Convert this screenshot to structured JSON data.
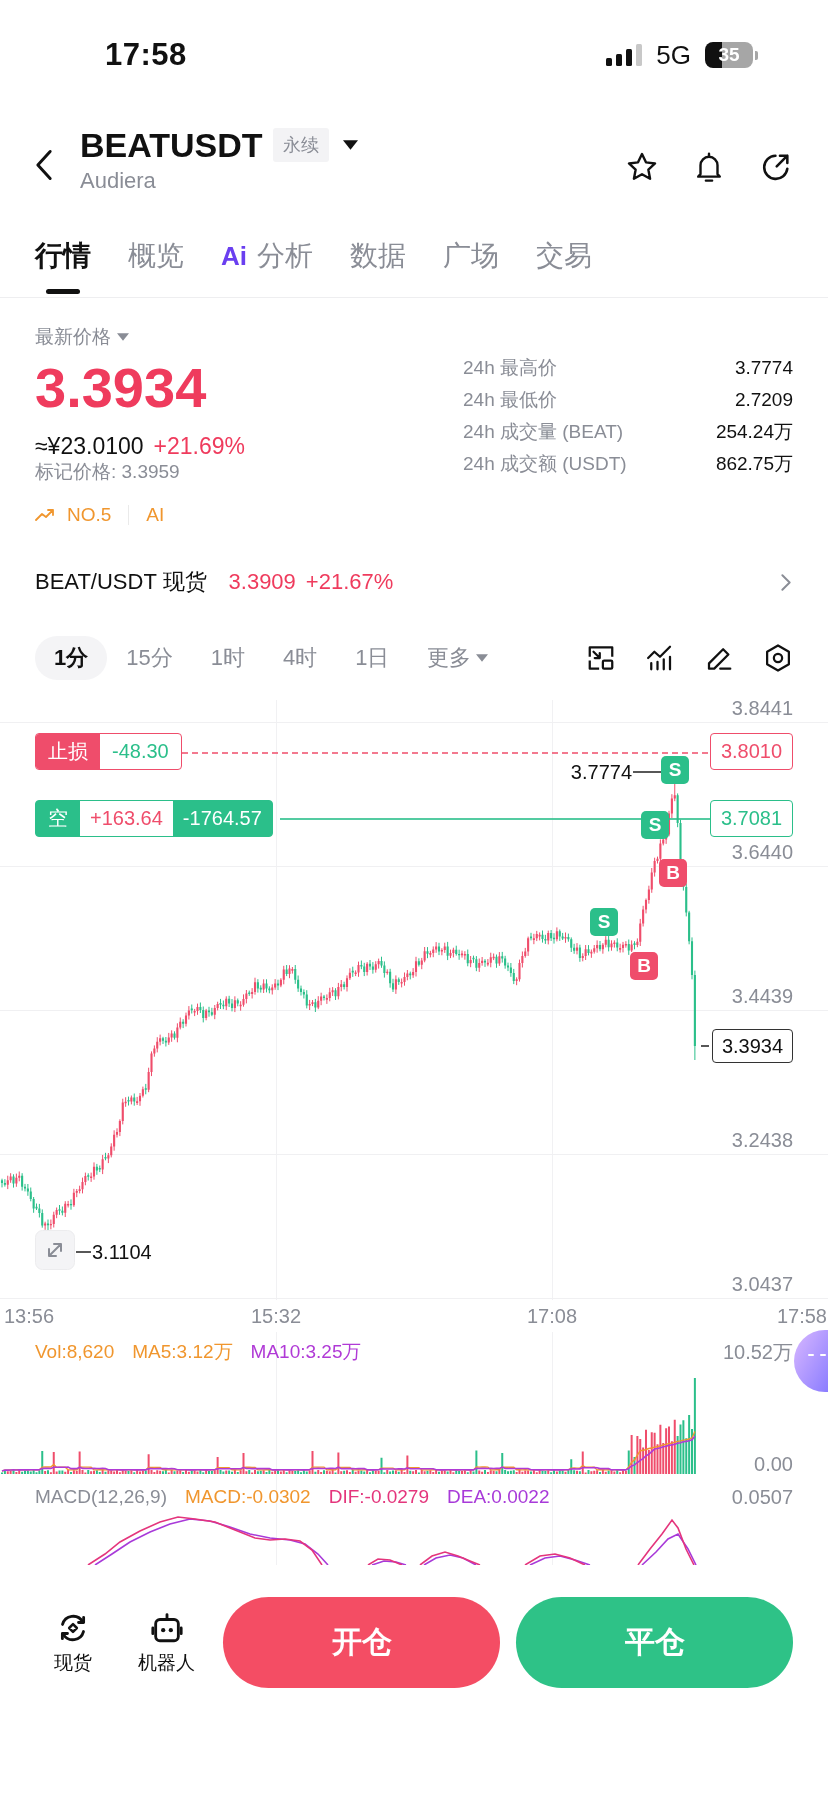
{
  "status_bar": {
    "time": "17:58",
    "network": "5G",
    "battery": "35"
  },
  "header": {
    "symbol": "BEATUSDT",
    "badge": "永续",
    "subtitle": "Audiera"
  },
  "tabs": [
    {
      "label": "行情",
      "selected": true
    },
    {
      "label": "概览",
      "selected": false
    },
    {
      "label": "分析",
      "icon_text": "Ai",
      "selected": false
    },
    {
      "label": "数据",
      "selected": false
    },
    {
      "label": "广场",
      "selected": false
    },
    {
      "label": "交易",
      "selected": false
    }
  ],
  "price": {
    "label": "最新价格",
    "last": "3.3934",
    "fiat": "≈¥23.0100",
    "change": "+21.69%",
    "mark": "标记价格: 3.3959",
    "rank": "NO.5",
    "ai": "AI"
  },
  "stats": [
    {
      "label": "24h 最高价",
      "value": "3.7774"
    },
    {
      "label": "24h 最低价",
      "value": "2.7209"
    },
    {
      "label": "24h 成交量 (BEAT)",
      "value": "254.24万"
    },
    {
      "label": "24h 成交额 (USDT)",
      "value": "862.75万"
    }
  ],
  "spot": {
    "pair": "BEAT/USDT 现货",
    "price": "3.3909",
    "change": "+21.67%"
  },
  "intervals": [
    {
      "label": "1分",
      "kind": "interval",
      "selected": true
    },
    {
      "label": "15分",
      "kind": "interval",
      "selected": false
    },
    {
      "label": "1时",
      "kind": "interval",
      "selected": false
    },
    {
      "label": "4时",
      "kind": "interval",
      "selected": false
    },
    {
      "label": "1日",
      "kind": "interval",
      "selected": false
    },
    {
      "label": "更多",
      "kind": "dropdown",
      "selected": false
    }
  ],
  "chart": {
    "price_axis": [
      "3.8441",
      "3.6440",
      "3.4439",
      "3.2438",
      "3.0437"
    ],
    "time_axis": [
      "13:56",
      "15:32",
      "17:08",
      "17:58"
    ],
    "stop_loss": {
      "label": "止损",
      "pnl": "-48.30",
      "price": "3.8010"
    },
    "position": {
      "side": "空",
      "pnl": "+163.64",
      "amount": "-1764.57",
      "price": "3.7081"
    },
    "high": "3.7774",
    "low": "3.1104",
    "last": "3.3934",
    "trades": [
      {
        "label": "S",
        "kind": "sell"
      },
      {
        "label": "S",
        "kind": "sell"
      },
      {
        "label": "B",
        "kind": "buy"
      },
      {
        "label": "S",
        "kind": "sell"
      },
      {
        "label": "B",
        "kind": "buy"
      }
    ]
  },
  "volume": {
    "legend": [
      {
        "label": "Vol:8,620",
        "color": "#f0962e"
      },
      {
        "label": "MA5:3.12万",
        "color": "#f0962e"
      },
      {
        "label": "MA10:3.25万",
        "color": "#b03ad6"
      }
    ],
    "max": "10.52万",
    "min": "0.00"
  },
  "macd": {
    "legend": [
      {
        "label": "MACD(12,26,9)",
        "color": "#8a8d96"
      },
      {
        "label": "MACD:-0.0302",
        "color": "#f0962e"
      },
      {
        "label": "DIF:-0.0279",
        "color": "#e4357c"
      },
      {
        "label": "DEA:0.0022",
        "color": "#a83ad9"
      }
    ],
    "max": "0.0507"
  },
  "bottom_nav": [
    {
      "label": "现货"
    },
    {
      "label": "机器人"
    }
  ],
  "actions": [
    {
      "label": "开仓",
      "kind": "open"
    },
    {
      "label": "平仓",
      "kind": "close"
    }
  ]
}
